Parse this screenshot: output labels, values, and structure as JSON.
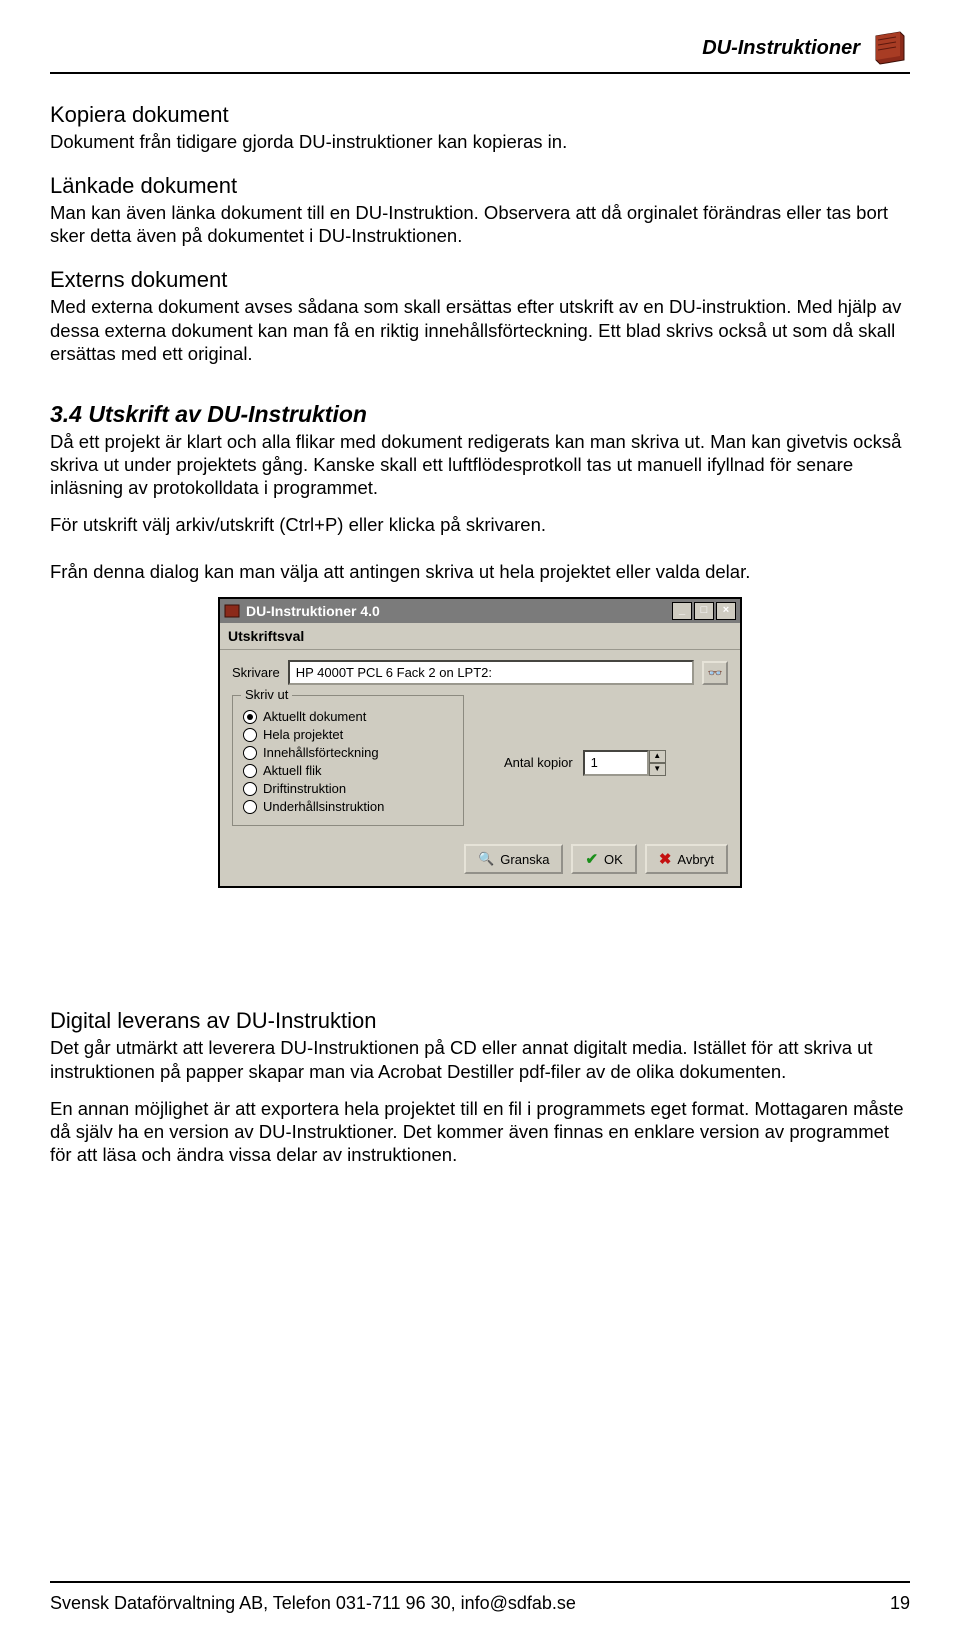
{
  "header": {
    "title": "DU-Instruktioner"
  },
  "sections": {
    "kopiera": {
      "title": "Kopiera dokument",
      "body": "Dokument från tidigare gjorda DU-instruktioner kan kopieras in."
    },
    "lankade": {
      "title": "Länkade dokument",
      "body": "Man kan även länka dokument till en DU-Instruktion. Observera att då orginalet förändras eller tas bort sker detta även på dokumentet i DU-Instruktionen."
    },
    "externs": {
      "title": "Externs dokument",
      "body": "Med externa dokument avses sådana som skall ersättas efter utskrift av en DU-instruktion. Med hjälp av dessa externa dokument kan man få en riktig innehållsförteckning. Ett blad skrivs också ut som då skall ersättas med ett original."
    },
    "utskrift": {
      "title": "3.4 Utskrift av DU-Instruktion",
      "p1": "Då ett projekt är klart och alla flikar med dokument redigerats kan man skriva ut. Man kan givetvis också skriva ut under projektets gång. Kanske skall ett luftflödesprotkoll tas ut manuell ifyllnad för senare inläsning av protokolldata i programmet.",
      "p2": "För utskrift välj arkiv/utskrift (Ctrl+P) eller klicka på skrivaren.",
      "p3": "Från denna dialog kan man välja att antingen skriva ut hela projektet eller valda delar."
    },
    "digital": {
      "title": "Digital leverans av DU-Instruktion",
      "p1": "Det går utmärkt att leverera DU-Instruktionen på CD eller annat digitalt media. Istället för att skriva ut instruktionen på papper skapar man via Acrobat Destiller pdf-filer av de olika dokumenten.",
      "p2": "En annan möjlighet är att exportera hela projektet till en fil i programmets eget format. Mottagaren måste då själv ha en version av DU-Instruktioner. Det kommer även finnas en enklare version av programmet för att läsa och ändra vissa delar av instruktionen."
    }
  },
  "dialog": {
    "title": "DU-Instruktioner 4.0",
    "subtitle": "Utskriftsval",
    "printer_label": "Skrivare",
    "printer_value": "HP 4000T PCL 6 Fack 2 on LPT2:",
    "group_label": "Skriv ut",
    "options": [
      "Aktuellt dokument",
      "Hela projektet",
      "Innehållsförteckning",
      "Aktuell flik",
      "Driftinstruktion",
      "Underhållsinstruktion"
    ],
    "copies_label": "Antal kopior",
    "copies_value": "1",
    "btn_preview": "Granska",
    "btn_ok": "OK",
    "btn_cancel": "Avbryt"
  },
  "footer": {
    "text": "Svensk Dataförvaltning AB, Telefon 031-711 96 30, info@sdfab.se",
    "page": "19"
  }
}
